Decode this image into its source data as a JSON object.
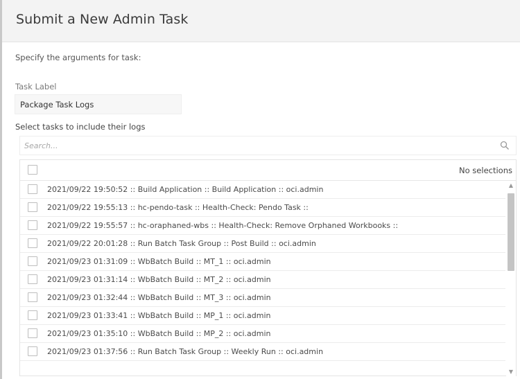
{
  "dialog": {
    "title": "Submit a New Admin Task",
    "instructions": "Specify the arguments for task:"
  },
  "task_label": {
    "label": "Task Label",
    "value": "Package Task Logs"
  },
  "task_select": {
    "help_text": "Select tasks to include their logs",
    "search_placeholder": "Search...",
    "selection_status": "No selections",
    "rows": [
      "2021/09/22 19:50:52 :: Build Application :: Build Application :: oci.admin",
      "2021/09/22 19:55:13 :: hc-pendo-task :: Health-Check: Pendo Task ::",
      "2021/09/22 19:55:57 :: hc-oraphaned-wbs :: Health-Check: Remove Orphaned Workbooks ::",
      "2021/09/22 20:01:28 :: Run Batch Task Group :: Post Build :: oci.admin",
      "2021/09/23 01:31:09 :: WbBatch Build :: MT_1 :: oci.admin",
      "2021/09/23 01:31:14 :: WbBatch Build :: MT_2 :: oci.admin",
      "2021/09/23 01:32:44 :: WbBatch Build :: MT_3 :: oci.admin",
      "2021/09/23 01:33:41 :: WbBatch Build :: MP_1 :: oci.admin",
      "2021/09/23 01:35:10 :: WbBatch Build :: MP_2 :: oci.admin",
      "2021/09/23 01:37:56 :: Run Batch Task Group :: Weekly Run :: oci.admin"
    ]
  },
  "icons": {
    "search": "search-icon",
    "scroll_up": "chevron-up-icon",
    "scroll_down": "chevron-down-icon"
  }
}
